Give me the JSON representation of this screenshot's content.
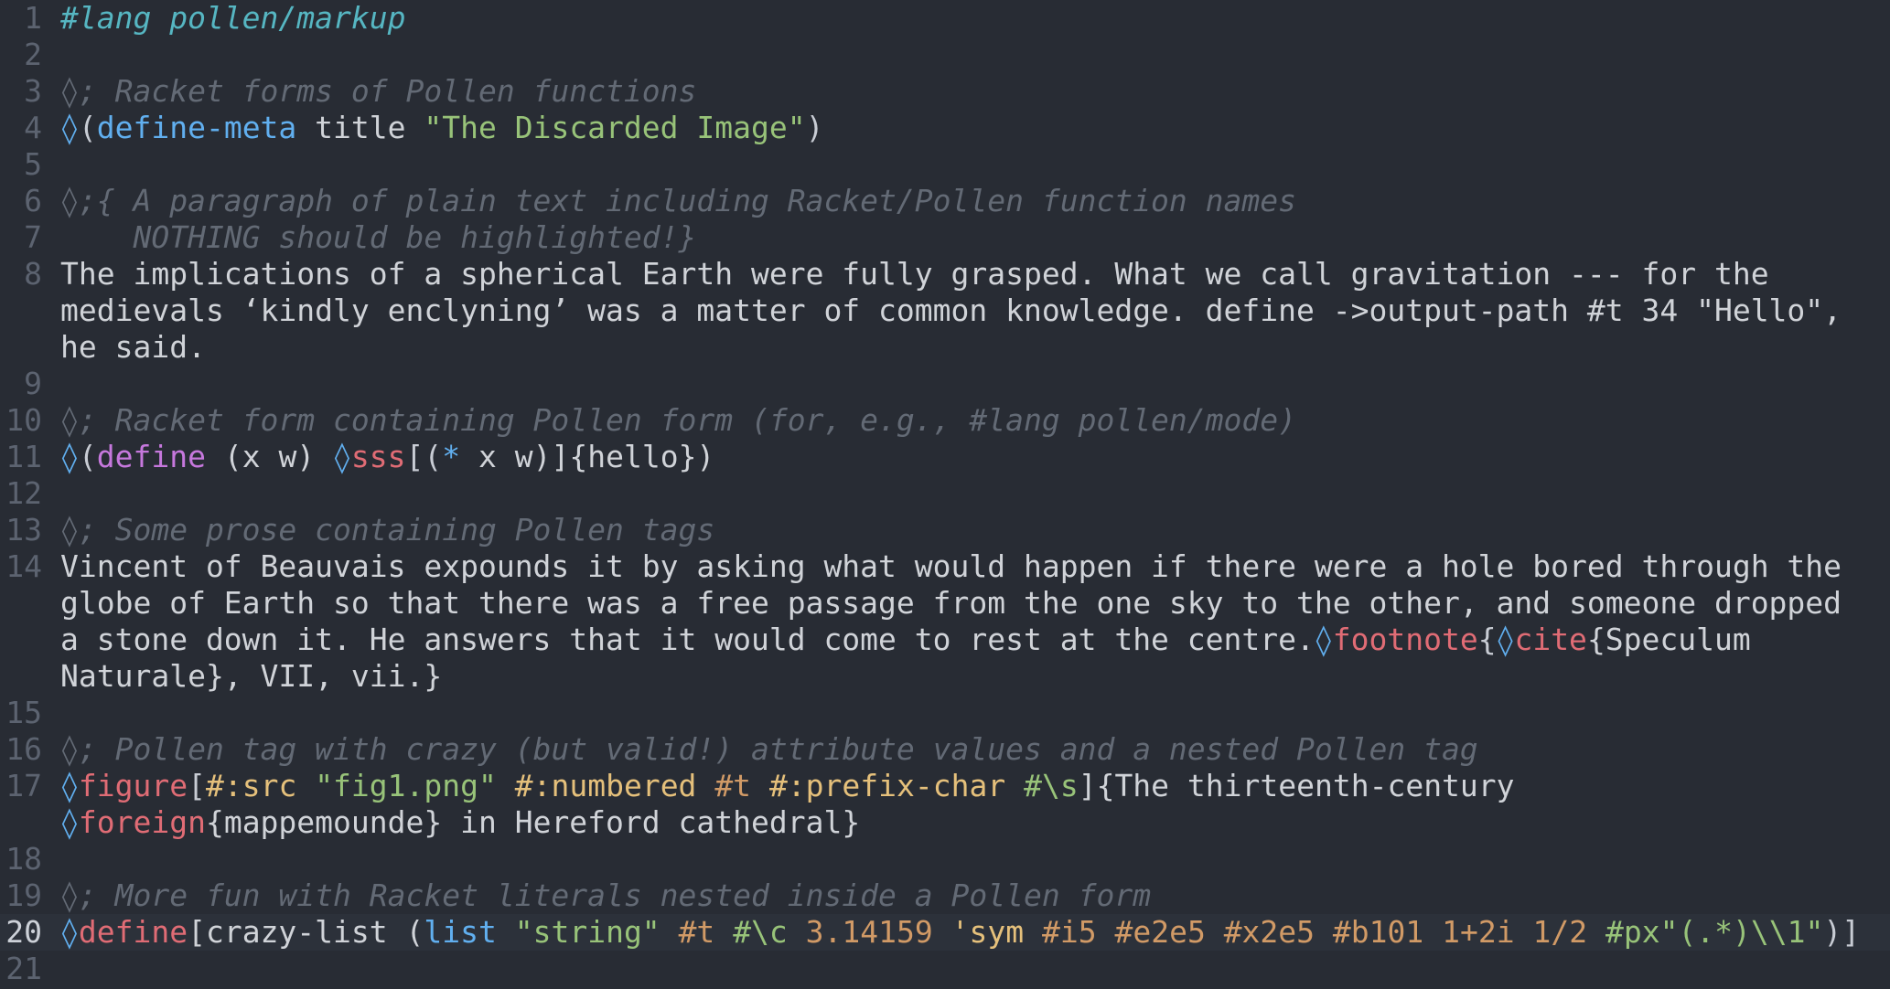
{
  "editor": {
    "rows": [
      {
        "n": "1",
        "current": false,
        "tokens": [
          {
            "t": "#lang pollen/markup",
            "c": "lang"
          }
        ]
      },
      {
        "n": "2",
        "current": false,
        "tokens": []
      },
      {
        "n": "3",
        "current": false,
        "tokens": [
          {
            "t": "◊; Racket forms of Pollen functions",
            "c": "comment"
          }
        ]
      },
      {
        "n": "4",
        "current": false,
        "tokens": [
          {
            "t": "◊",
            "c": "loz"
          },
          {
            "t": "(",
            "c": "punct"
          },
          {
            "t": "define-meta",
            "c": "kw"
          },
          {
            "t": " title ",
            "c": "text"
          },
          {
            "t": "\"The Discarded Image\"",
            "c": "str"
          },
          {
            "t": ")",
            "c": "punct"
          }
        ]
      },
      {
        "n": "5",
        "current": false,
        "tokens": []
      },
      {
        "n": "6",
        "current": false,
        "tokens": [
          {
            "t": "◊;{ A paragraph of plain text including Racket/Pollen function names",
            "c": "comment"
          }
        ]
      },
      {
        "n": "7",
        "current": false,
        "tokens": [
          {
            "t": "    NOTHING should be highlighted!}",
            "c": "comment"
          }
        ]
      },
      {
        "n": "8",
        "current": false,
        "tokens": [
          {
            "t": "The implications of a spherical Earth were fully grasped. What we call gravitation --- for the",
            "c": "text"
          }
        ]
      },
      {
        "n": "",
        "current": false,
        "tokens": [
          {
            "t": "medievals ‘kindly enclyning’ was a matter of common knowledge. define ->output-path #t 34 \"Hello\",",
            "c": "text"
          }
        ]
      },
      {
        "n": "",
        "current": false,
        "tokens": [
          {
            "t": "he said.",
            "c": "text"
          }
        ]
      },
      {
        "n": "9",
        "current": false,
        "tokens": []
      },
      {
        "n": "10",
        "current": false,
        "tokens": [
          {
            "t": "◊; Racket form containing Pollen form (for, e.g., #lang pollen/mode)",
            "c": "comment"
          }
        ]
      },
      {
        "n": "11",
        "current": false,
        "tokens": [
          {
            "t": "◊",
            "c": "loz"
          },
          {
            "t": "(",
            "c": "punct"
          },
          {
            "t": "define",
            "c": "def"
          },
          {
            "t": " (x w) ",
            "c": "text"
          },
          {
            "t": "◊",
            "c": "loz"
          },
          {
            "t": "sss",
            "c": "tag"
          },
          {
            "t": "[(",
            "c": "punct"
          },
          {
            "t": "*",
            "c": "kw"
          },
          {
            "t": " x w)]{hello})",
            "c": "text"
          }
        ]
      },
      {
        "n": "12",
        "current": false,
        "tokens": []
      },
      {
        "n": "13",
        "current": false,
        "tokens": [
          {
            "t": "◊; Some prose containing Pollen tags",
            "c": "comment"
          }
        ]
      },
      {
        "n": "14",
        "current": false,
        "tokens": [
          {
            "t": "Vincent of Beauvais expounds it by asking what would happen if there were a hole bored through the",
            "c": "text"
          }
        ]
      },
      {
        "n": "",
        "current": false,
        "tokens": [
          {
            "t": "globe of Earth so that there was a free passage from the one sky to the other, and someone dropped",
            "c": "text"
          }
        ]
      },
      {
        "n": "",
        "current": false,
        "tokens": [
          {
            "t": "a stone down it. He answers that it would come to rest at the centre.",
            "c": "text"
          },
          {
            "t": "◊",
            "c": "loz"
          },
          {
            "t": "footnote",
            "c": "tag"
          },
          {
            "t": "{",
            "c": "punct"
          },
          {
            "t": "◊",
            "c": "loz"
          },
          {
            "t": "cite",
            "c": "tag"
          },
          {
            "t": "{Speculum",
            "c": "text"
          }
        ]
      },
      {
        "n": "",
        "current": false,
        "tokens": [
          {
            "t": "Naturale}, VII, vii.}",
            "c": "text"
          }
        ]
      },
      {
        "n": "15",
        "current": false,
        "tokens": []
      },
      {
        "n": "16",
        "current": false,
        "tokens": [
          {
            "t": "◊; Pollen tag with crazy (but valid!) attribute values and a nested Pollen tag",
            "c": "comment"
          }
        ]
      },
      {
        "n": "17",
        "current": false,
        "tokens": [
          {
            "t": "◊",
            "c": "loz"
          },
          {
            "t": "figure",
            "c": "tag"
          },
          {
            "t": "[",
            "c": "punct"
          },
          {
            "t": "#:src",
            "c": "kwd"
          },
          {
            "t": " ",
            "c": "text"
          },
          {
            "t": "\"fig1.png\"",
            "c": "str"
          },
          {
            "t": " ",
            "c": "text"
          },
          {
            "t": "#:numbered",
            "c": "kwd"
          },
          {
            "t": " ",
            "c": "text"
          },
          {
            "t": "#t",
            "c": "const"
          },
          {
            "t": " ",
            "c": "text"
          },
          {
            "t": "#:prefix-char",
            "c": "kwd"
          },
          {
            "t": " ",
            "c": "text"
          },
          {
            "t": "#\\s",
            "c": "str"
          },
          {
            "t": "]{The thirteenth-century",
            "c": "text"
          }
        ]
      },
      {
        "n": "",
        "current": false,
        "tokens": [
          {
            "t": "◊",
            "c": "loz"
          },
          {
            "t": "foreign",
            "c": "tag"
          },
          {
            "t": "{mappemounde} in Hereford cathedral}",
            "c": "text"
          }
        ]
      },
      {
        "n": "18",
        "current": false,
        "tokens": []
      },
      {
        "n": "19",
        "current": false,
        "tokens": [
          {
            "t": "◊; More fun with Racket literals nested inside a Pollen form",
            "c": "comment"
          }
        ]
      },
      {
        "n": "20",
        "current": true,
        "tokens": [
          {
            "t": "◊",
            "c": "loz"
          },
          {
            "t": "define",
            "c": "tag"
          },
          {
            "t": "[crazy-list (",
            "c": "text"
          },
          {
            "t": "list",
            "c": "kw"
          },
          {
            "t": " ",
            "c": "text"
          },
          {
            "t": "\"string\"",
            "c": "str"
          },
          {
            "t": " ",
            "c": "text"
          },
          {
            "t": "#t",
            "c": "const"
          },
          {
            "t": " ",
            "c": "text"
          },
          {
            "t": "#\\c",
            "c": "str"
          },
          {
            "t": " ",
            "c": "text"
          },
          {
            "t": "3.14159",
            "c": "num"
          },
          {
            "t": " ",
            "c": "text"
          },
          {
            "t": "'sym",
            "c": "sym"
          },
          {
            "t": " ",
            "c": "text"
          },
          {
            "t": "#i5",
            "c": "num"
          },
          {
            "t": " ",
            "c": "text"
          },
          {
            "t": "#e2e5",
            "c": "num"
          },
          {
            "t": " ",
            "c": "text"
          },
          {
            "t": "#x2e5",
            "c": "num"
          },
          {
            "t": " ",
            "c": "text"
          },
          {
            "t": "#b101",
            "c": "num"
          },
          {
            "t": " ",
            "c": "text"
          },
          {
            "t": "1+2i",
            "c": "num"
          },
          {
            "t": " ",
            "c": "text"
          },
          {
            "t": "1/2",
            "c": "num"
          },
          {
            "t": " ",
            "c": "text"
          },
          {
            "t": "#px\"(.*)\\\\1\"",
            "c": "str"
          },
          {
            "t": ")]",
            "c": "punct"
          }
        ]
      },
      {
        "n": "21",
        "current": false,
        "tokens": []
      }
    ]
  },
  "colors": {
    "background": "#282c34",
    "current_line": "#2c313a",
    "gutter": "#5c6370",
    "comment": "#636a75",
    "string": "#98c379",
    "tag": "#e06c75",
    "builtin": "#61afef",
    "keyword_arg": "#e5c07b",
    "number": "#d19a66",
    "define": "#c678dd",
    "lang": "#56b6c2"
  }
}
